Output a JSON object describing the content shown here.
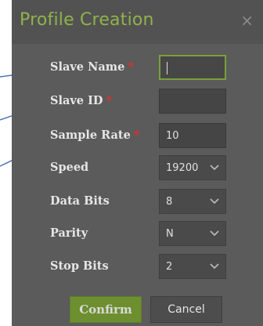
{
  "dialog": {
    "title": "Profile Creation",
    "close_glyph": "×"
  },
  "form": {
    "slave_name": {
      "label": "Slave Name",
      "required_mark": "*",
      "value": ""
    },
    "slave_id": {
      "label": "Slave ID",
      "required_mark": "*",
      "value": ""
    },
    "sample_rate": {
      "label": "Sample Rate",
      "required_mark": "*",
      "value": "10"
    },
    "speed": {
      "label": "Speed",
      "value": "19200"
    },
    "data_bits": {
      "label": "Data Bits",
      "value": "8"
    },
    "parity": {
      "label": "Parity",
      "value": "N"
    },
    "stop_bits": {
      "label": "Stop Bits",
      "value": "2"
    }
  },
  "buttons": {
    "confirm_label": "Confirm",
    "cancel_label": "Cancel"
  },
  "colors": {
    "title": "#8fb34a",
    "required": "#e02f2f",
    "confirm_bg": "#6d8f2f",
    "arrow": "#4a6ab8"
  },
  "icons": {
    "close": "close-icon",
    "dropdown": "chevron-down-icon",
    "annotation": "arrow-icon"
  }
}
